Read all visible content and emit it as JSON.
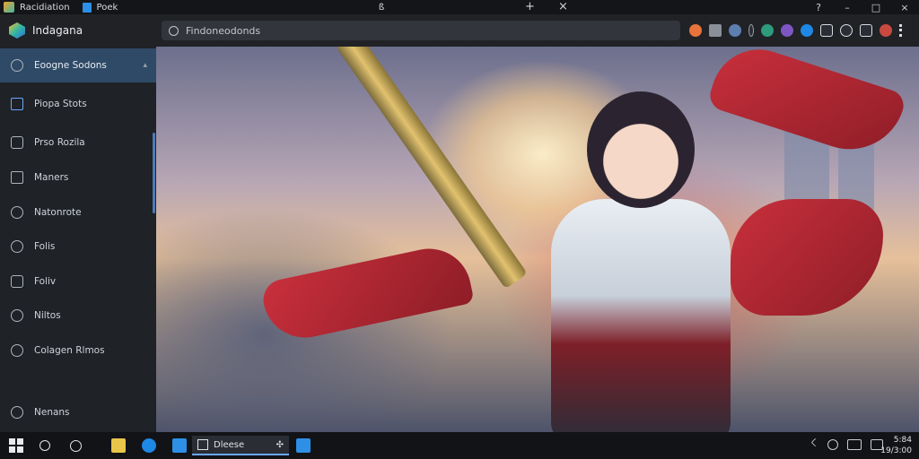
{
  "window": {
    "title": "Racidiation",
    "doc_tab": "Poek",
    "center_tab": "ß",
    "add_tab": "+",
    "close_tab": "×",
    "controls": {
      "help": "?",
      "minimize": "–",
      "maximize": "□",
      "close": "×"
    }
  },
  "topbar": {
    "brand": "Indagana",
    "search_placeholder": "Findoneodonds",
    "extensions": [
      "orange-ext-icon",
      "puzzle-icon",
      "ext-icon",
      "paint-icon",
      "ext-icon",
      "ext-icon",
      "ext-icon",
      "ext-icon",
      "ext-icon",
      "ext-icon",
      "avatar",
      "more-icon"
    ]
  },
  "sidebar": {
    "items": [
      {
        "label": "Eoogne Sodons",
        "icon": "clock-icon",
        "active": true
      },
      {
        "label": "Piopa Stots",
        "icon": "home-icon",
        "selected": true
      },
      {
        "label": "Prso Rozila",
        "icon": "tag-icon"
      },
      {
        "label": "Maners",
        "icon": "window-icon"
      },
      {
        "label": "Natonrote",
        "icon": "leaf-icon"
      },
      {
        "label": "Folis",
        "icon": "user-icon"
      },
      {
        "label": "Foliv",
        "icon": "pound-icon"
      },
      {
        "label": "Niltos",
        "icon": "x-circle-icon"
      },
      {
        "label": "Colagen Rlmos",
        "icon": "gear-icon"
      },
      {
        "label": "Nenans",
        "icon": "clock-icon"
      }
    ]
  },
  "taskbar": {
    "active_task": "Dleese",
    "clock_time": "5:84",
    "clock_date": "19/3:00"
  },
  "colors": {
    "accent": "#6aa7ff",
    "sidebar_active": "#2f4a66",
    "scarf_red": "#c9303c"
  }
}
